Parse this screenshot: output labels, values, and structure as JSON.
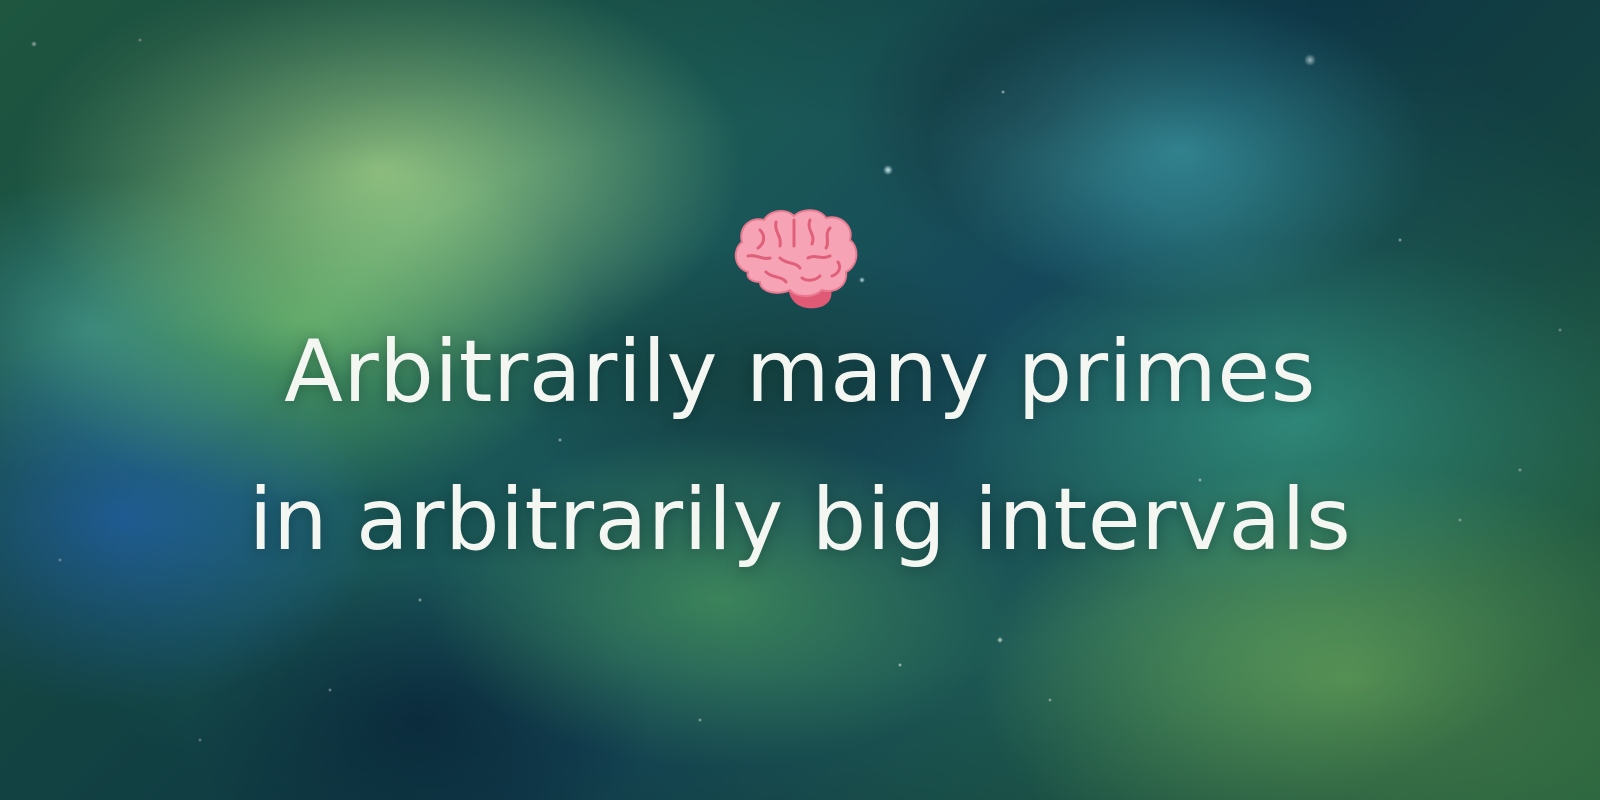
{
  "title": {
    "line1": "Arbitrarily many primes",
    "line2": "in arbitrarily big intervals"
  },
  "icon": {
    "name": "brain-icon",
    "color": "#f47a8f"
  },
  "colors": {
    "text": "#f4f6f2",
    "background_dominant": "#1b5a56"
  }
}
